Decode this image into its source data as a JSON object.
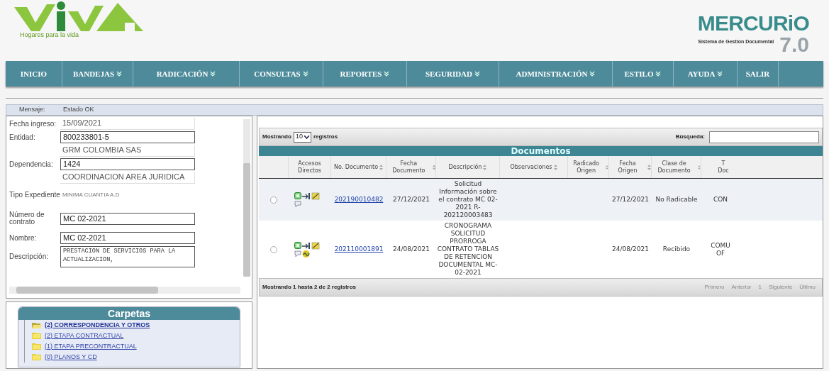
{
  "header": {
    "logo_tagline": "Hogares para la vida",
    "product": {
      "name": "MERCURiO",
      "subtitle": "Sistema de Gestion Documental",
      "version": "7.0"
    }
  },
  "nav": [
    {
      "label": "INICIO",
      "has_menu": false
    },
    {
      "label": "BANDEJAS",
      "has_menu": true
    },
    {
      "label": "RADICACIÓN",
      "has_menu": true
    },
    {
      "label": "CONSULTAS",
      "has_menu": true
    },
    {
      "label": "REPORTES",
      "has_menu": true
    },
    {
      "label": "SEGURIDAD",
      "has_menu": true
    },
    {
      "label": "ADMINISTRACIÓN",
      "has_menu": true
    },
    {
      "label": "ESTILO",
      "has_menu": true
    },
    {
      "label": "AYUDA",
      "has_menu": true
    },
    {
      "label": "SALIR",
      "has_menu": false
    }
  ],
  "message_bar": {
    "label": "Mensaje:",
    "value": "Estado OK"
  },
  "form": [
    {
      "label": "Fecha ingreso:",
      "kind": "plain",
      "value": "15/09/2021"
    },
    {
      "label": "Entidad:",
      "kind": "field",
      "value": "800233801-5"
    },
    {
      "kind": "plain",
      "value": "GRM COLOMBIA SAS"
    },
    {
      "label": "Dependencia:",
      "kind": "field",
      "value": "1424"
    },
    {
      "kind": "plain",
      "value": "COORDINACION AREA JURIDICA"
    },
    {
      "label": "Tipo Expediente",
      "kind": "muted",
      "value": "MINIMA CUANTIA A.D"
    },
    {
      "label": "Número de contrato",
      "kind": "field",
      "value": "MC 02-2021"
    },
    {
      "label": "Nombre:",
      "kind": "field",
      "value": "MC 02-2021"
    },
    {
      "label": "Descripción:",
      "kind": "textarea",
      "value": "PRESTACION DE SERVICIOS PARA LA ACTUALIZACION,"
    }
  ],
  "folders": {
    "title": "Carpetas",
    "items": [
      {
        "label": "(2) CORRESPONDENCIA Y OTROS",
        "open": true
      },
      {
        "label": "(2) ETAPA CONTRACTUAL",
        "open": false
      },
      {
        "label": "(1) ETAPA PRECONTRACTUAL",
        "open": false
      },
      {
        "label": "(0) PLANOS Y CD",
        "open": false
      }
    ]
  },
  "table": {
    "length_prefix": "Mostrando",
    "length_value": "10",
    "length_suffix": "registros",
    "search_label": "Búsqueda:",
    "title": "Documentos",
    "columns": [
      {
        "sortable": false
      },
      {
        "label": "Accesos Directos",
        "sortable": false
      },
      {
        "label": "No. Documento",
        "sortable": true
      },
      {
        "label": "Fecha Documento",
        "sortable": true
      },
      {
        "label": "Descripción",
        "sortable": true
      },
      {
        "label": "Observaciones",
        "sortable": true
      },
      {
        "label": "Radicado Origen",
        "sortable": true
      },
      {
        "label": "Fecha Origen",
        "sortable": true
      },
      {
        "label": "Clase de Documento",
        "sortable": true
      },
      {
        "label": "T Doc",
        "sortable": false
      }
    ],
    "rows": [
      {
        "selected": false,
        "highlighted": true,
        "extra_icon": false,
        "number": "202190010482",
        "date": "27/12/2021",
        "description": "Solicitud Información sobre el contrato MC 02-2021 R-202120003483",
        "origin_date": "27/12/2021",
        "class": "No Radicable",
        "column_10": "CON"
      },
      {
        "selected": false,
        "highlighted": false,
        "extra_icon": true,
        "number": "202110001891",
        "date": "24/08/2021",
        "description": "CRONOGRAMA SOLICITUD PRORROGA CONTRATO TABLAS DE RETENCION DOCUMENTAL MC-02-2021",
        "origin_date": "24/08/2021",
        "class": "Recibido",
        "column_10": "COMU OF"
      }
    ],
    "info": "Mostrando 1 hasta 2 de 2 registros",
    "pagination": [
      {
        "label": "Primero",
        "disabled": true
      },
      {
        "label": "Anterior",
        "disabled": true
      },
      {
        "label": "1",
        "disabled": true
      },
      {
        "label": "Siguiente",
        "disabled": true
      },
      {
        "label": "Último",
        "disabled": true
      }
    ]
  }
}
